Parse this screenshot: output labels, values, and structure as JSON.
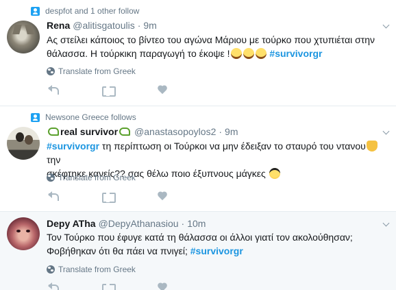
{
  "tweets": [
    {
      "context": "despfot and 1 other follow",
      "name": "Rena",
      "handle": "@alitisgatoulis",
      "separator": "·",
      "time": "9m",
      "text_line1": "Ας στείλει κάποιος το βίντεο του αγώνα  Μάριου με τούρκο που χτυπιέται στην",
      "text_line2": "θάλασσα.  Η τούρκικη παραγωγή το έκοψε !",
      "hashtag": "#survivorgr",
      "emojis": [
        "face-with-tears-of-joy",
        "face-with-tears-of-joy",
        "face-with-tears-of-joy"
      ],
      "translate": "Translate from Greek"
    },
    {
      "context": "Newsone Greece follows",
      "name": "real survivor",
      "handle": "@anastasopoylos2",
      "separator": "·",
      "time": "9m",
      "hashtag": "#survivorgr",
      "text_line1_rest": " τη περίπτωση οι Τούρκοι να μην έδειξαν το σταυρό του ντανου",
      "text_line1_end": "την",
      "text_line2": "σκέφτηκε κανείς?? σας θέλω ποιο έξυπνους μάγκες",
      "emojis": [
        "green-squiggle",
        "raising-hands",
        "smiling-face-with-sunglasses"
      ],
      "translate": "Translate from Greek"
    },
    {
      "name": "Depy ATha",
      "handle": "@DepyAthanasiou",
      "separator": "·",
      "time": "10m",
      "text_line1": "Τον Τούρκο που έφυγε κατά τη θάλασσα οι άλλοι γιατί τον ακολούθησαν;",
      "text_line2": "Φοβήθηκαν ότι θα πάει να πνιγεί;",
      "hashtag": "#survivorgr",
      "translate": "Translate from Greek"
    }
  ],
  "colors": {
    "hashtag": "#1b95e0",
    "muted": "#657786",
    "action_icons": "#aab8c2",
    "highlight_bg": "#f5f8fa"
  },
  "icons": [
    "follow-icon",
    "globe-icon",
    "reply-icon",
    "retweet-icon",
    "like-icon",
    "chevron-down-icon"
  ]
}
